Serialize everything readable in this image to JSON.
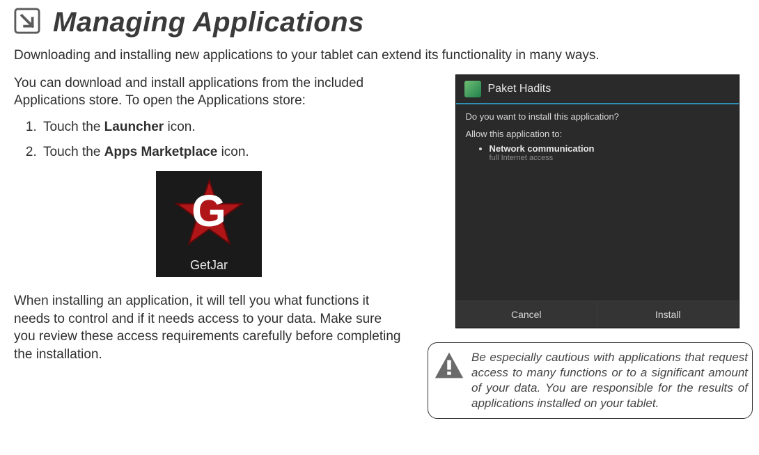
{
  "heading": {
    "title": "Managing Applications"
  },
  "intro": "Downloading and installing new applications to your tablet can extend its functionality in many ways.",
  "left": {
    "para1": "You can download and install applications from the included Applications store. To open the Applications store:",
    "steps": [
      {
        "prefix": "Touch the ",
        "bold": "Launcher",
        "suffix": " icon."
      },
      {
        "prefix": "Touch the ",
        "bold": "Apps Marketplace",
        "suffix": " icon."
      }
    ],
    "getjar_label": "GetJar",
    "getjar_letter": "G",
    "para2": "When installing an application, it will tell you what functions it needs to control and if it needs access to your data. Make sure you review these access requirements carefully before completing the installation."
  },
  "dialog": {
    "app_title": "Paket Hadits",
    "question": "Do you want to install this application?",
    "allow_label": "Allow this application to:",
    "permissions": [
      {
        "title": "Network communication",
        "sub": "full Internet access"
      }
    ],
    "cancel": "Cancel",
    "install": "Install"
  },
  "caution": {
    "text": "Be especially cautious with applications that request access to many functions or to a significant amount of your data. You are responsible for the results of applications installed on your tablet."
  }
}
